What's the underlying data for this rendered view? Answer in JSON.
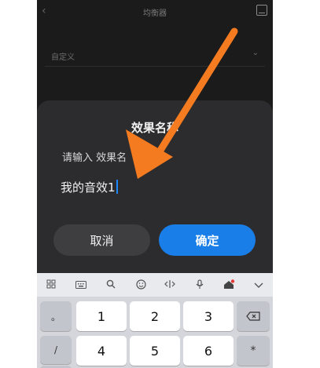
{
  "header": {
    "back_icon": "chevron-left-icon",
    "title": "均衡器",
    "save_icon": "save-icon"
  },
  "preset": {
    "label": "自定义",
    "chevron": "chevron-down-icon"
  },
  "dialog": {
    "title": "效果名称",
    "hint": "请输入 效果名",
    "input_value": "我的音效1",
    "cancel_label": "取消",
    "confirm_label": "确定"
  },
  "keyboard": {
    "toolbar": [
      "grid-icon",
      "keyboard-icon",
      "search-icon",
      "emoji-icon",
      "cursor-icon",
      "mic-icon",
      "skin-icon",
      "collapse-icon"
    ],
    "row1": {
      "side": "。",
      "keys": [
        "1",
        "2",
        "3"
      ],
      "action": "⌫"
    },
    "row2": {
      "side": "/",
      "keys": [
        "4",
        "5",
        "6"
      ],
      "action": "*"
    },
    "row3": {
      "side": "+"
    }
  },
  "colors": {
    "accent": "#1a7ee8",
    "arrow": "#f47b20",
    "dialog_bg": "#2c2c2e"
  }
}
